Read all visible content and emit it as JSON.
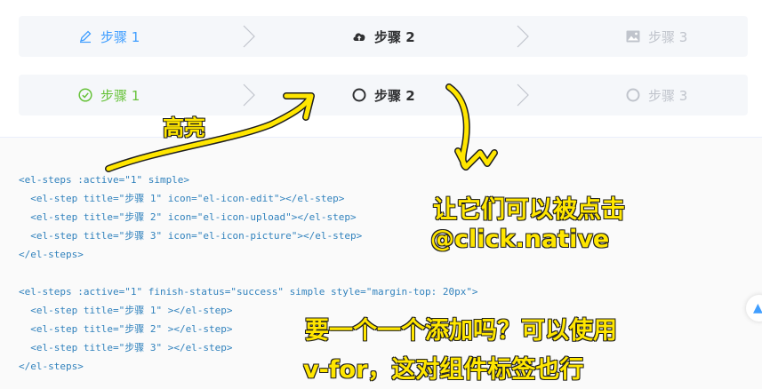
{
  "steps_simple": {
    "items": [
      {
        "title": "步骤 1",
        "icon": "edit-icon",
        "status": "process"
      },
      {
        "title": "步骤 2",
        "icon": "upload-icon",
        "status": "finish"
      },
      {
        "title": "步骤 3",
        "icon": "picture-icon",
        "status": "wait"
      }
    ]
  },
  "steps_success": {
    "items": [
      {
        "title": "步骤 1",
        "icon": "success-circle-icon",
        "status": "success"
      },
      {
        "title": "步骤 2",
        "icon": "circle-icon",
        "status": "process"
      },
      {
        "title": "步骤 3",
        "icon": "circle-icon",
        "status": "wait"
      }
    ]
  },
  "colors": {
    "process": "#409eff",
    "finish": "#303133",
    "wait": "#c0c4cc",
    "success": "#67c23a",
    "annotation": "#ffe600"
  },
  "code": {
    "lines": [
      "<el-steps :active=\"1\" simple>",
      "  <el-step title=\"步骤 1\" icon=\"el-icon-edit\"></el-step>",
      "  <el-step title=\"步骤 2\" icon=\"el-icon-upload\"></el-step>",
      "  <el-step title=\"步骤 3\" icon=\"el-icon-picture\"></el-step>",
      "</el-steps>",
      "",
      "<el-steps :active=\"1\" finish-status=\"success\" simple style=\"margin-top: 20px\">",
      "  <el-step title=\"步骤 1\" ></el-step>",
      "  <el-step title=\"步骤 2\" ></el-step>",
      "  <el-step title=\"步骤 3\" ></el-step>",
      "</el-steps>"
    ]
  },
  "annotations": {
    "highlight": "高亮",
    "clickable": "让它们可以被点击",
    "click_native": "@click.native",
    "question": "要一个一个添加吗？可以使用",
    "vfor": "v-for，这对组件标签也行"
  }
}
